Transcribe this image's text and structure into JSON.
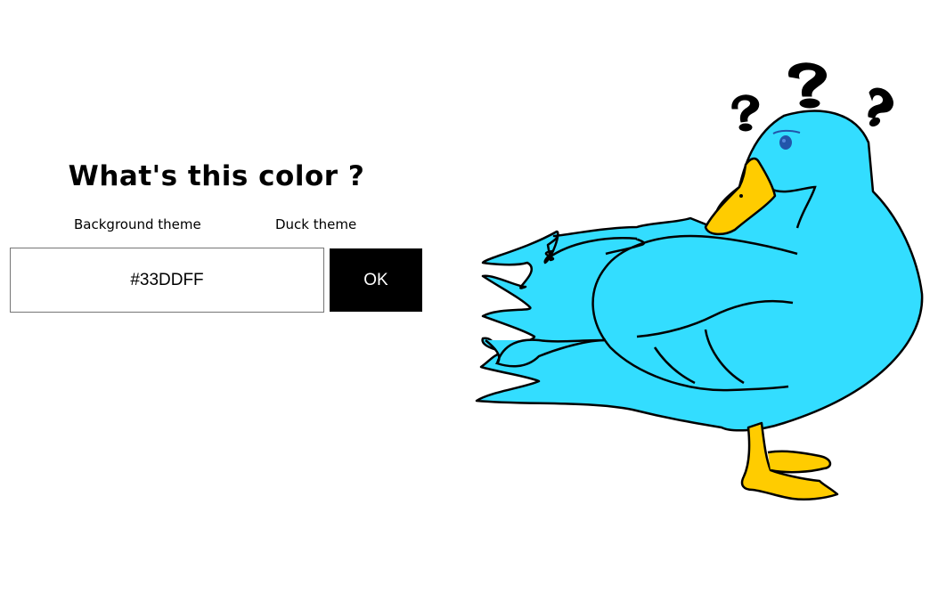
{
  "title": "What's this color ?",
  "themes": {
    "background_label": "Background theme",
    "duck_label": "Duck theme"
  },
  "color_input": {
    "value": "#33DDFF"
  },
  "ok_button": {
    "label": "OK"
  },
  "duck": {
    "body_color": "#33DDFF",
    "beak_color": "#FFCC00",
    "eye_color": "#2255AA",
    "outline_color": "#000000"
  }
}
